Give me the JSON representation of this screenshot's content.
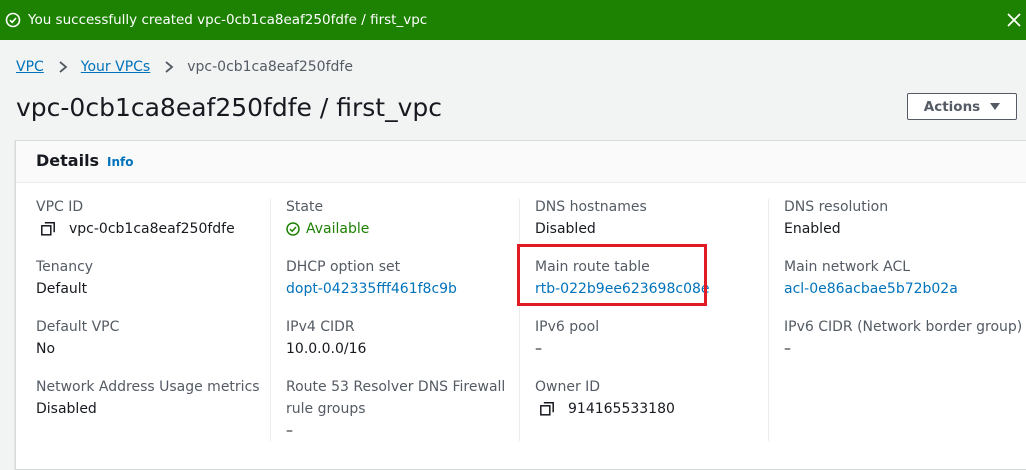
{
  "flash": {
    "message": "You successfully created vpc-0cb1ca8eaf250fdfe / first_vpc",
    "color": "#1d8102"
  },
  "breadcrumb": {
    "items": [
      "VPC",
      "Your VPCs"
    ],
    "current": "vpc-0cb1ca8eaf250fdfe"
  },
  "page": {
    "title": "vpc-0cb1ca8eaf250fdfe / first_vpc",
    "actions_label": "Actions"
  },
  "details": {
    "heading": "Details",
    "info": "Info",
    "vpc_id_label": "VPC ID",
    "vpc_id": "vpc-0cb1ca8eaf250fdfe",
    "state_label": "State",
    "state": "Available",
    "dns_hostnames_label": "DNS hostnames",
    "dns_hostnames": "Disabled",
    "dns_resolution_label": "DNS resolution",
    "dns_resolution": "Enabled",
    "tenancy_label": "Tenancy",
    "tenancy": "Default",
    "dhcp_label": "DHCP option set",
    "dhcp": "dopt-042335fff461f8c9b",
    "main_route_table_label": "Main route table",
    "main_route_table": "rtb-022b9ee623698c08e",
    "main_acl_label": "Main network ACL",
    "main_acl": "acl-0e86acbae5b72b02a",
    "default_vpc_label": "Default VPC",
    "default_vpc": "No",
    "ipv4_cidr_label": "IPv4 CIDR",
    "ipv4_cidr": "10.0.0.0/16",
    "ipv6_pool_label": "IPv6 pool",
    "ipv6_pool": "–",
    "ipv6_cidr_label": "IPv6 CIDR (Network border group)",
    "ipv6_cidr": "–",
    "nau_label": "Network Address Usage metrics",
    "nau": "Disabled",
    "r53_label_line1": "Route 53 Resolver DNS Firewall",
    "r53_label_line2": "rule groups",
    "r53": "–",
    "owner_label": "Owner ID",
    "owner": "914165533180"
  }
}
